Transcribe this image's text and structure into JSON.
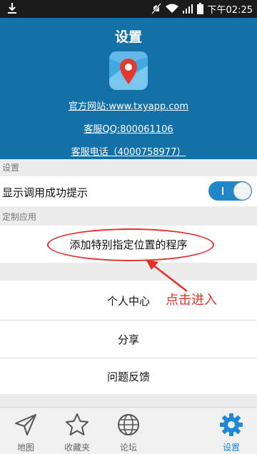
{
  "status_bar": {
    "time": "下午02:25"
  },
  "header": {
    "title": "设置",
    "website": "官方网站:www.txyapp.com",
    "qq": "客服QQ:800061106",
    "phone": "客服电话（4000758977）"
  },
  "settings": {
    "section_label": "设置",
    "call_success_hint_label": "显示调用成功提示",
    "call_success_hint_on": true,
    "toggle_mark": "I"
  },
  "custom_apps": {
    "section_label": "定制应用",
    "add_program_label": "添加特别指定位置的程序"
  },
  "menu": {
    "personal_center": "个人中心",
    "share": "分享",
    "feedback": "问题反馈"
  },
  "annotation": {
    "text": "点击进入",
    "color": "#e5302a"
  },
  "bottom_nav": {
    "items": [
      {
        "label": "地图",
        "icon": "paper-plane-icon"
      },
      {
        "label": "收藏夹",
        "icon": "star-icon"
      },
      {
        "label": "论坛",
        "icon": "globe-icon"
      },
      {
        "label": "设置",
        "icon": "gear-icon",
        "active": true
      }
    ]
  },
  "colors": {
    "header_bg": "#1471a7",
    "accent": "#1e88d6",
    "toggle_on": "#1f86c8"
  }
}
